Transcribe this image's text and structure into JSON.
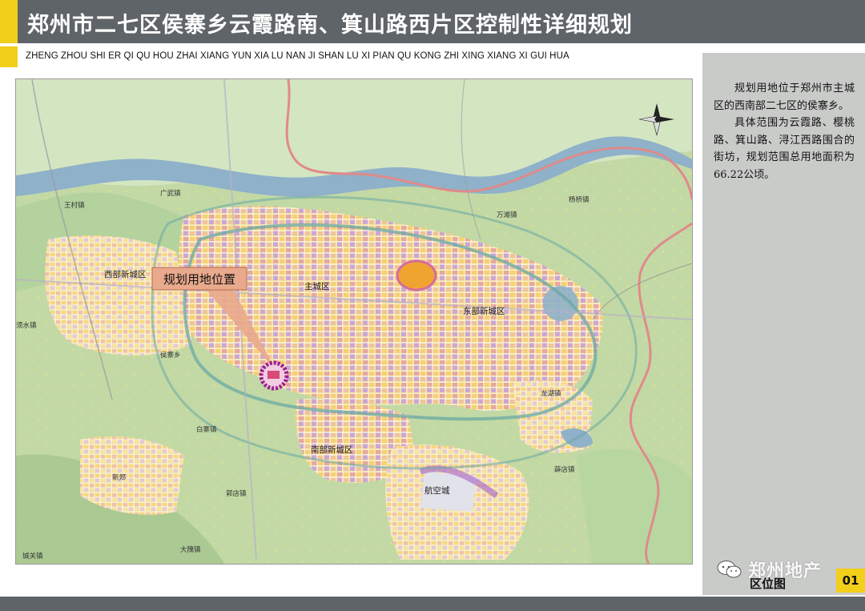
{
  "header": {
    "title": "郑州市二七区侯寨乡云霞路南、箕山路西片区控制性详细规划",
    "subtitle": "ZHENG ZHOU SHI ER QI QU HOU ZHAI XIANG YUN XIA LU NAN JI SHAN LU XI PIAN QU KONG ZHI XING XIANG XI GUI HUA"
  },
  "map": {
    "callout": "规划用地位置",
    "districts": {
      "main": "主城区",
      "west": "西部新城区",
      "east": "东部新城区",
      "south": "南部新城区",
      "airport": "航空城"
    },
    "towns": {
      "t1": "王村镇",
      "t2": "广武镇",
      "t3": "杨桥镇",
      "t4": "万滩镇",
      "t5": "须水镇",
      "t6": "侯寨乡",
      "t7": "白寨镇",
      "t8": "新郑",
      "t9": "龙湖镇",
      "t10": "薛店镇",
      "t11": "郭店镇",
      "t12": "大隗镇",
      "t13": "城关镇"
    },
    "colors": {
      "river": "#8fb1c9",
      "boundary": "#e08a8a",
      "site_ring": "#9b1f8f",
      "callout_fill": "#e9a98c"
    }
  },
  "description": {
    "p1": "规划用地位于郑州市主城区的西南部二七区的侯寨乡。",
    "p2": "具体范围为云霞路、樱桃路、箕山路、浔江西路围合的街坊，规划范围总用地面积为66.22公顷。"
  },
  "footer": {
    "caption": "区位图",
    "page_number": "01",
    "watermark": "郑州地产"
  }
}
